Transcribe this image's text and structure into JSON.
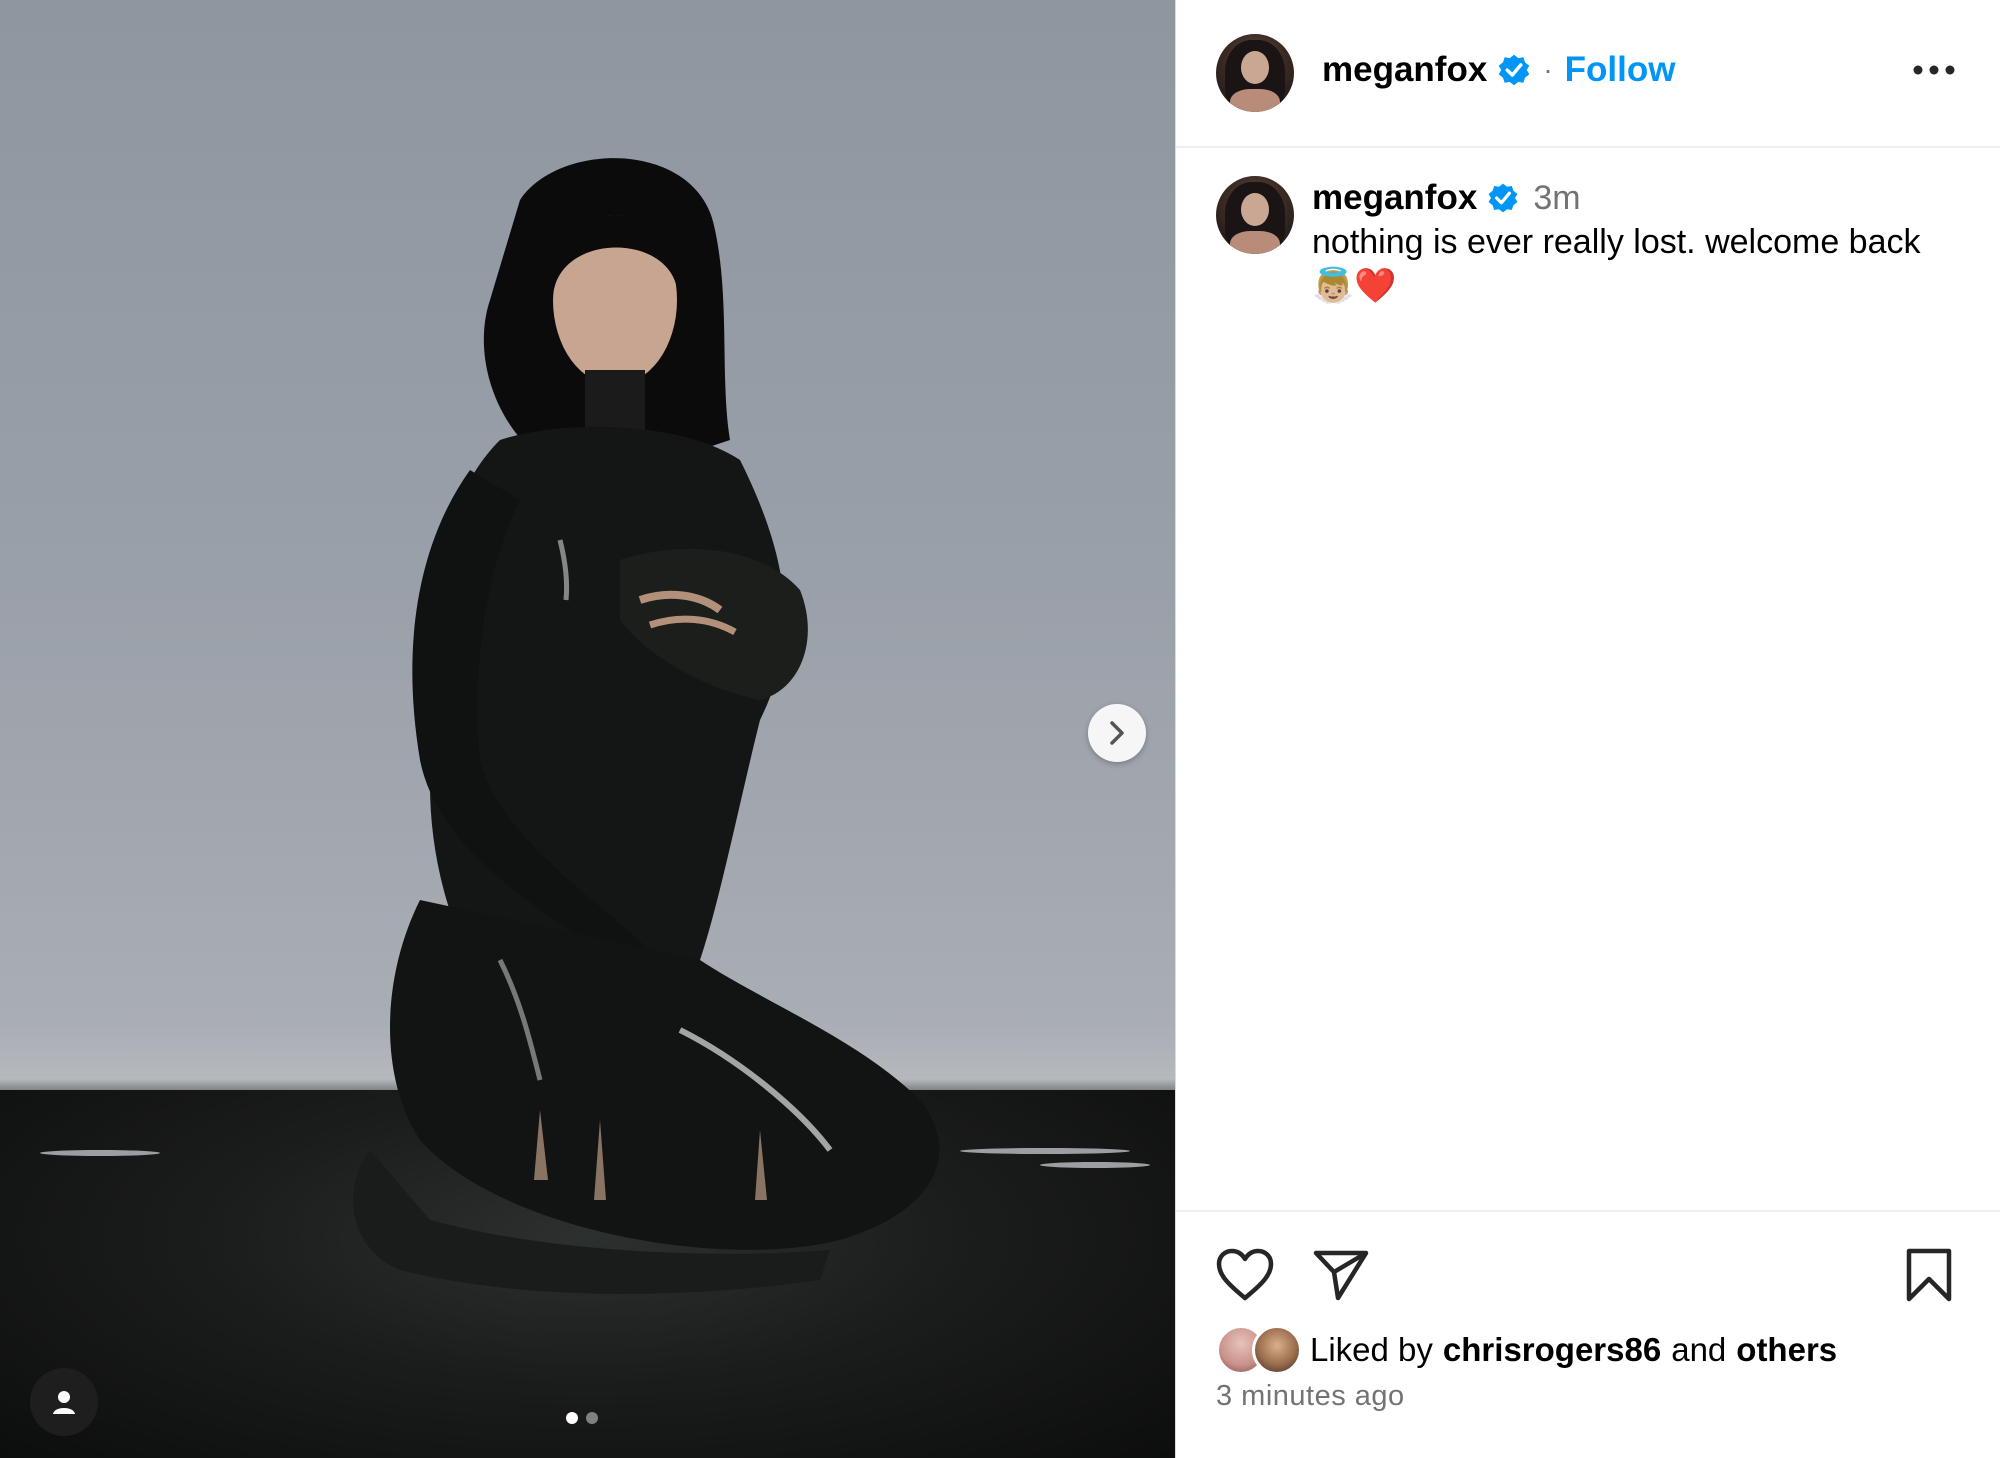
{
  "post": {
    "author": "meganfox",
    "follow_label": "Follow",
    "separator": "·",
    "caption_author": "meganfox",
    "caption_time": "3m",
    "caption_text": "nothing is ever really lost. welcome back",
    "caption_emojis": "👼🏼❤️",
    "liked_by_prefix": "Liked by",
    "liked_by_user": "chrisrogers86",
    "liked_by_and": "and",
    "liked_by_others": "others",
    "time_ago": "3 minutes ago"
  },
  "carousel": {
    "slide_count": 2,
    "active_slide": 1
  },
  "icons": {
    "more": "more-options-icon",
    "like": "heart-icon",
    "share": "paper-plane-icon",
    "save": "bookmark-icon",
    "next": "chevron-right-icon",
    "tagged": "user-tag-icon",
    "verified": "verified-badge-icon"
  },
  "colors": {
    "link_blue": "#0095f6",
    "verified_blue": "#0095f6",
    "secondary_text": "#737373",
    "divider": "#efefef"
  }
}
